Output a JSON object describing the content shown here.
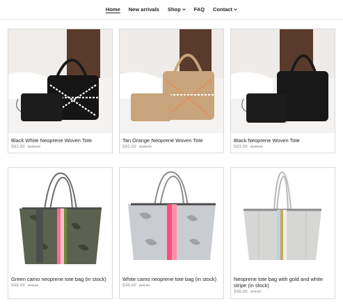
{
  "nav": {
    "items": [
      {
        "label": "Home",
        "active": true,
        "dropdown": false
      },
      {
        "label": "New arrivals",
        "active": false,
        "dropdown": false
      },
      {
        "label": "Shop",
        "active": false,
        "dropdown": true
      },
      {
        "label": "FAQ",
        "active": false,
        "dropdown": false
      },
      {
        "label": "Contact",
        "active": false,
        "dropdown": true
      }
    ]
  },
  "products": [
    {
      "title": "Black White Neoprene Woven Tote",
      "sale_price": "$83.00",
      "original_price": "$138.00"
    },
    {
      "title": "Tan Orange Neoprene Woven Tote",
      "sale_price": "$83.00",
      "original_price": "$138.00"
    },
    {
      "title": "Black Neoprene Woven Tote",
      "sale_price": "$83.00",
      "original_price": "$138.00"
    },
    {
      "title": "Green camo neoprene tote bag (in stock)",
      "sale_price": "$48.00",
      "original_price": "$78.00"
    },
    {
      "title": "White camo neoprene tote bag (in stock)",
      "sale_price": "$48.00",
      "original_price": "$78.00"
    },
    {
      "title": "Neoprene tote bag with gold and white stripe (in stock)",
      "sale_price": "$48.00",
      "original_price": "$78.00"
    }
  ],
  "colors": {
    "text": "#222222",
    "muted_price": "#b4b4b4",
    "border": "#d9d9d9"
  }
}
